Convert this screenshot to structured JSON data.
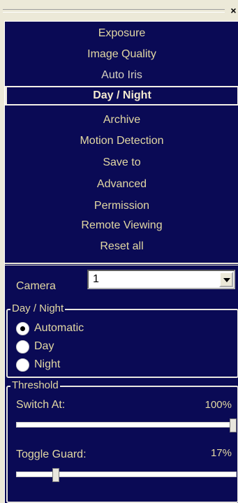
{
  "close_glyph": "×",
  "menu": {
    "items": [
      {
        "label": "Exposure"
      },
      {
        "label": "Image Quality"
      },
      {
        "label": "Auto Iris"
      },
      {
        "label": "Day / Night"
      },
      {
        "label": "Archive"
      },
      {
        "label": "Motion Detection"
      },
      {
        "label": "Save to"
      },
      {
        "label": "Advanced"
      },
      {
        "label": "Permission"
      },
      {
        "label": "Remote Viewing"
      },
      {
        "label": "Reset all"
      }
    ],
    "selected": "Day / Night"
  },
  "camera": {
    "label": "Camera",
    "value": "1"
  },
  "day_night": {
    "legend": "Day / Night",
    "options": [
      "Automatic",
      "Day",
      "Night"
    ],
    "selected": "Automatic"
  },
  "threshold": {
    "legend": "Threshold",
    "switch_at": {
      "label": "Switch At:",
      "value_text": "100%",
      "level": 1.0
    },
    "toggle_guard": {
      "label": "Toggle Guard:",
      "value_text": "17%",
      "level": 0.17
    }
  },
  "colors": {
    "panel_bg": "#0a0a55",
    "text": "#e2d8a3",
    "chrome": "#ece9d8"
  }
}
